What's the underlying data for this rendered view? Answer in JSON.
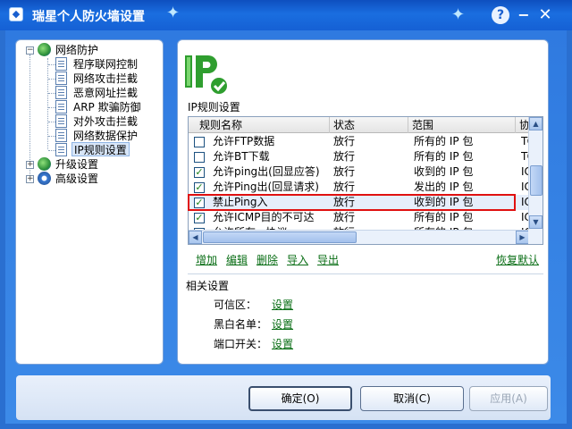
{
  "window": {
    "title": "瑞星个人防火墙设置",
    "help": "?",
    "minimize": "−",
    "close": "✕"
  },
  "tree": {
    "root_label": "网络防护",
    "children": [
      "程序联网控制",
      "网络攻击拦截",
      "恶意网址拦截",
      "ARP 欺骗防御",
      "对外攻击拦截",
      "网络数据保护",
      "IP规则设置"
    ],
    "upgrade_label": "升级设置",
    "advanced_label": "高级设置",
    "expander_open": "−",
    "expander_closed": "+"
  },
  "main": {
    "section_title": "IP规则设置",
    "columns": [
      "规则名称",
      "状态",
      "范围",
      "协"
    ],
    "rows": [
      {
        "checked": false,
        "name": "允许FTP数据",
        "status": "放行",
        "range": "所有的 IP 包",
        "proto": "TC"
      },
      {
        "checked": false,
        "name": "允许BT下载",
        "status": "放行",
        "range": "所有的 IP 包",
        "proto": "TC"
      },
      {
        "checked": true,
        "name": "允许ping出(回显应答)",
        "status": "放行",
        "range": "收到的 IP 包",
        "proto": "IC"
      },
      {
        "checked": true,
        "name": "允许Ping出(回显请求)",
        "status": "放行",
        "range": "发出的 IP 包",
        "proto": "IC"
      },
      {
        "checked": true,
        "name": "禁止Ping入",
        "status": "放行",
        "range": "收到的 IP 包",
        "proto": "IC"
      },
      {
        "checked": true,
        "name": "允许ICMP目的不可达",
        "status": "放行",
        "range": "所有的 IP 包",
        "proto": "IC"
      },
      {
        "checked": false,
        "name": "允许所有...协议",
        "status": "放行",
        "range": "所有的 IP 包",
        "proto": "IC"
      }
    ],
    "check_mark": "✓",
    "actions": {
      "add": "增加",
      "edit": "编辑",
      "delete": "删除",
      "import": "导入",
      "export": "导出",
      "restore": "恢复默认"
    },
    "related_title": "相关设置",
    "related": [
      {
        "label": "可信区：",
        "link": "设置"
      },
      {
        "label": "黑白名单：",
        "link": "设置"
      },
      {
        "label": "端口开关：",
        "link": "设置"
      }
    ],
    "scroll": {
      "up": "▲",
      "down": "▼",
      "left": "◀",
      "right": "▶"
    }
  },
  "buttons": {
    "ok": "确定(O)",
    "cancel": "取消(C)",
    "apply": "应用(A)"
  },
  "colors": {
    "titlebar": "#1560d4",
    "link": "#0a6e16",
    "selection_outline": "#e01010"
  }
}
